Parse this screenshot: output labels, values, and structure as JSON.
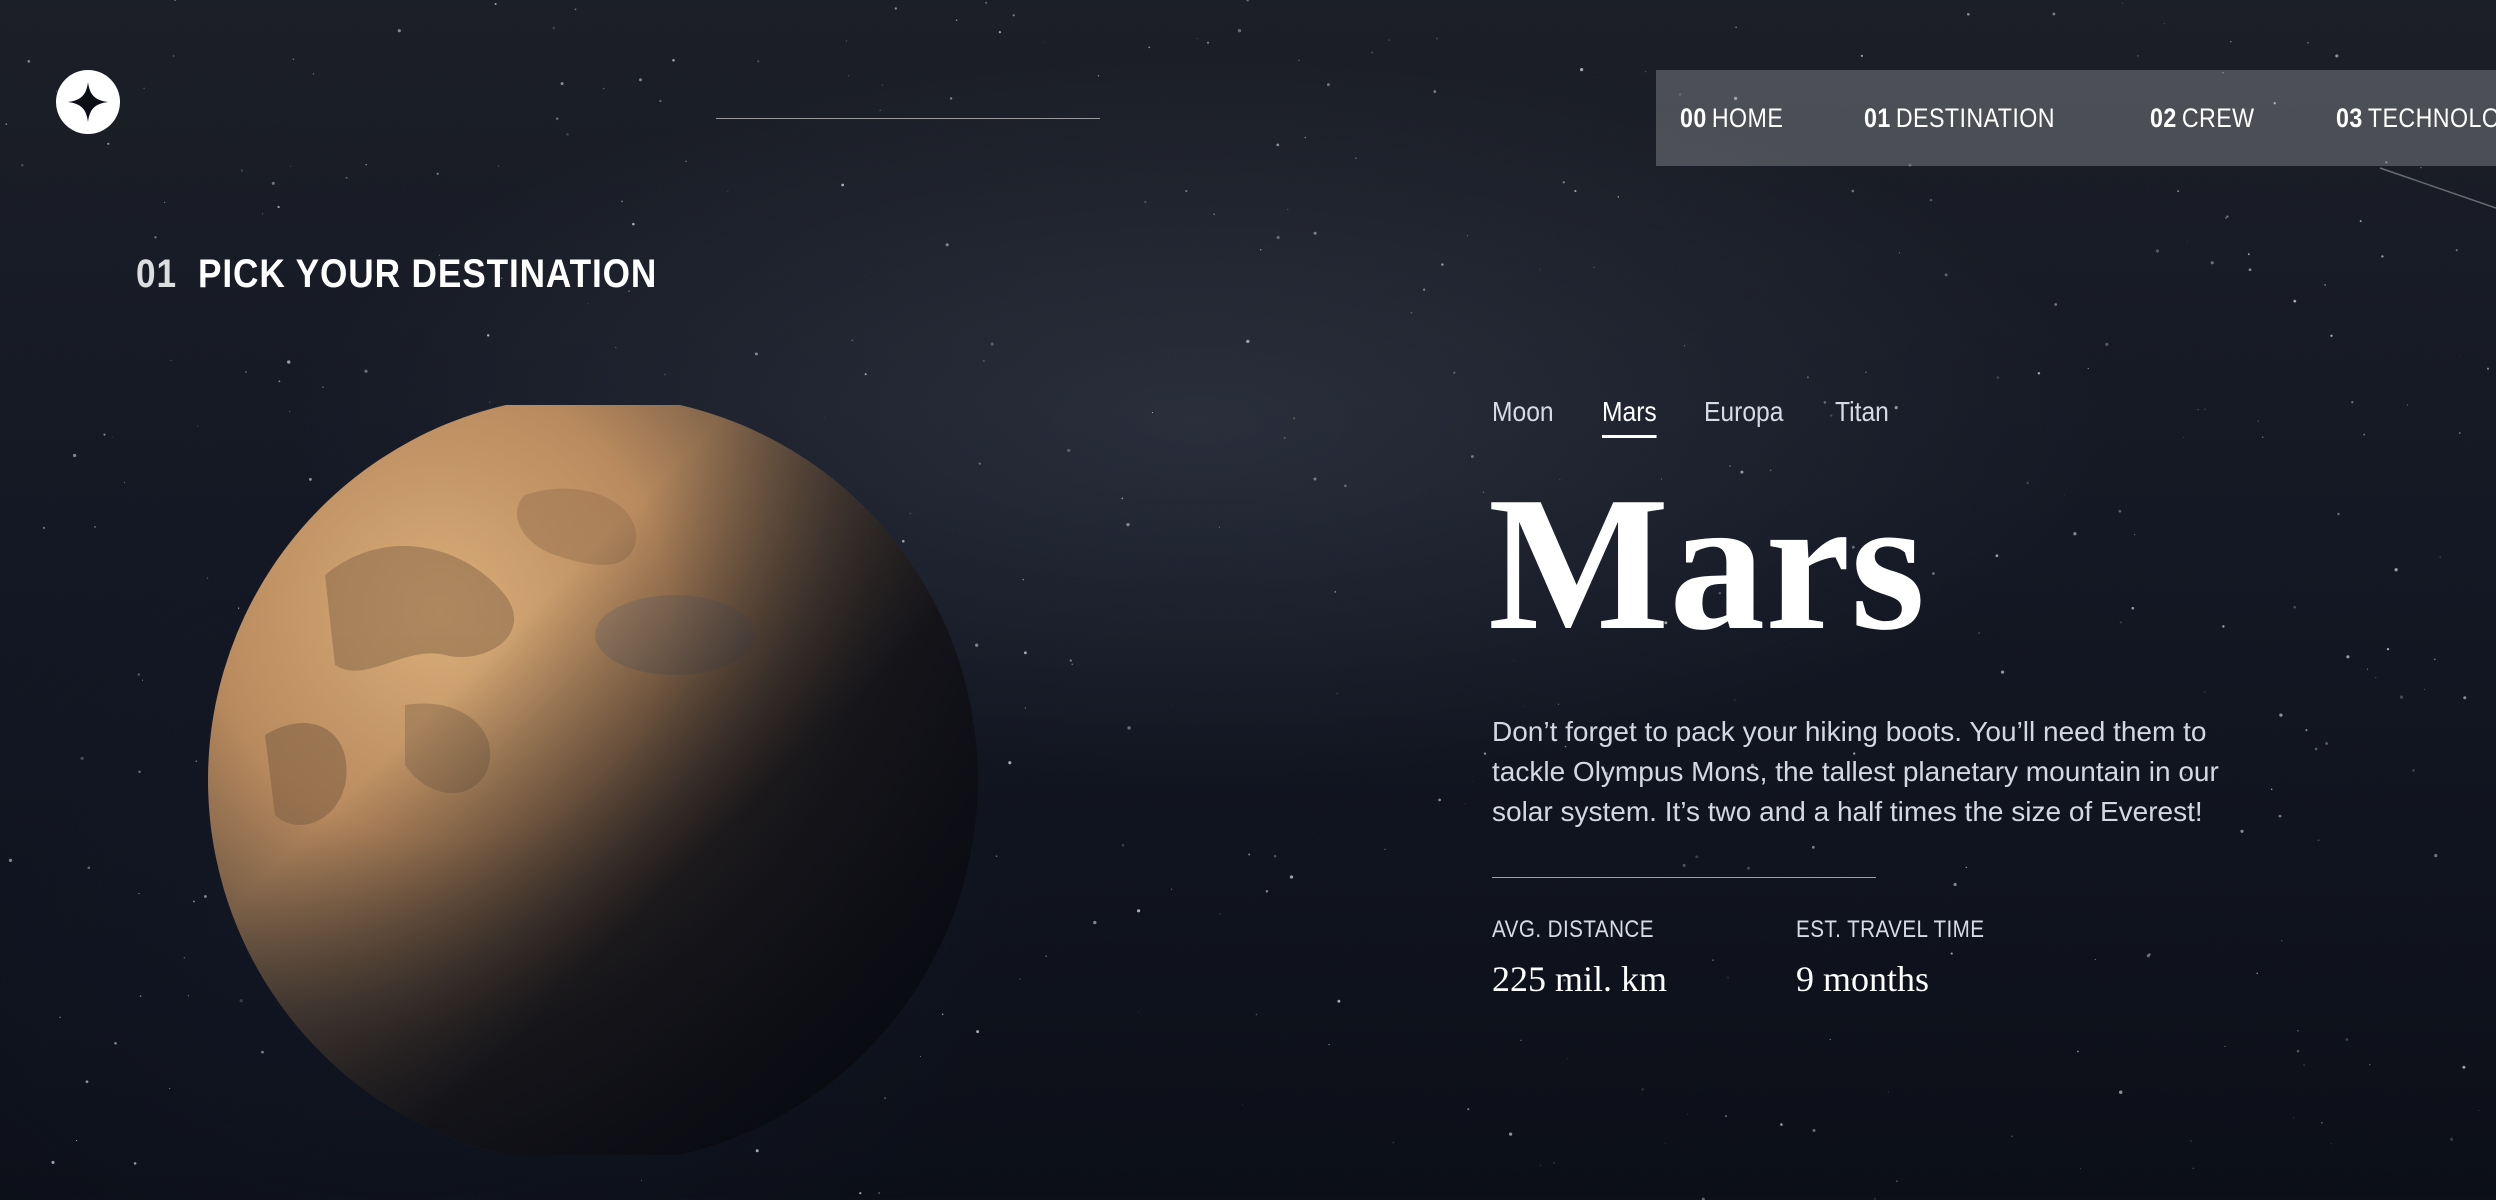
{
  "header": {
    "logo_icon": "four-point-star-icon"
  },
  "nav": {
    "items": [
      {
        "num": "00",
        "label": "HOME"
      },
      {
        "num": "01",
        "label": "DESTINATION"
      },
      {
        "num": "02",
        "label": "CREW"
      },
      {
        "num": "03",
        "label": "TECHNOLOGY"
      }
    ],
    "active": "DESTINATION"
  },
  "page": {
    "heading_num": "01",
    "heading": "PICK YOUR DESTINATION"
  },
  "destination": {
    "tabs": [
      "Moon",
      "Mars",
      "Europa",
      "Titan"
    ],
    "selected_tab": "Mars",
    "name": "Mars",
    "description": "Don’t forget to pack your hiking boots. You’ll need them to tackle Olympus Mons, the tallest planetary mountain in our solar system. It’s two and a half times the size of Everest!",
    "stats": {
      "distance_label": "AVG. DISTANCE",
      "distance_value": "225 mil. km",
      "travel_label": "EST. TRAVEL TIME",
      "travel_value": "9 months"
    }
  },
  "colors": {
    "background_top": "#1c1f27",
    "background_bottom": "#0c0f18",
    "nav_background": "rgba(255,255,255,0.22)",
    "text_primary": "#ffffff",
    "text_secondary": "#d3d8e3",
    "planet_surface": "#c89a66"
  }
}
